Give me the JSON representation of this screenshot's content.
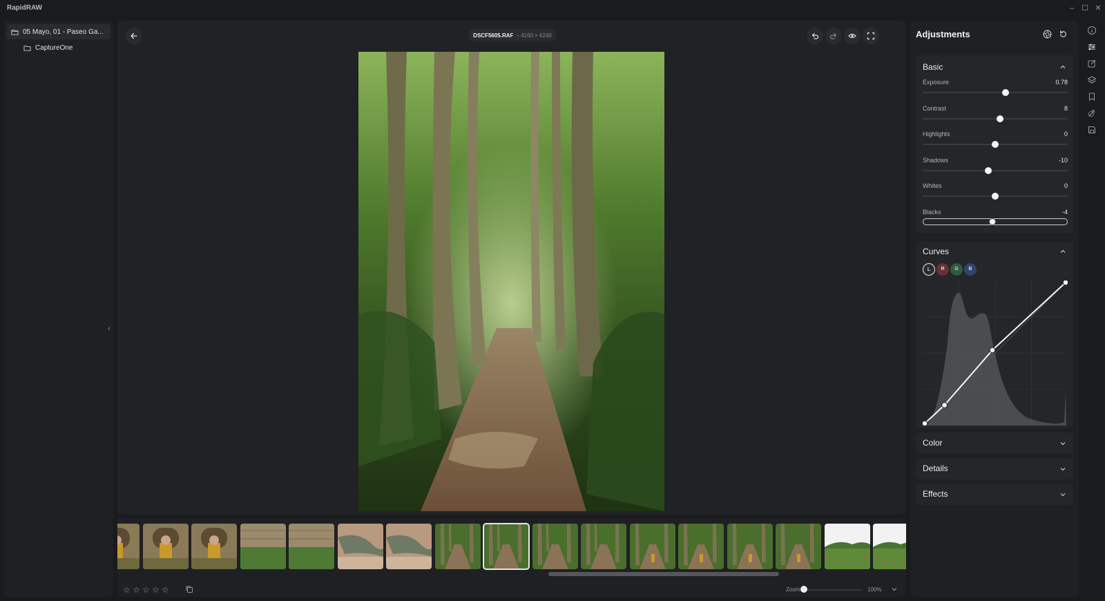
{
  "app": {
    "title": "RapidRAW"
  },
  "window": {
    "minimize": "–",
    "maximize": "☐",
    "close": "✕"
  },
  "sidebar": {
    "folders": [
      {
        "label": "05 Mayo, 01 - Paseo Ga...",
        "active": true
      },
      {
        "label": "CaptureOne",
        "active": false
      }
    ],
    "collapse_glyph": "‹"
  },
  "viewer": {
    "file_name": "DSCF5605.RAF",
    "file_dims": "– 4160 × 6240"
  },
  "filmstrip": {
    "thumbnails": [
      {
        "kind": "portrait-person",
        "selected": false
      },
      {
        "kind": "portrait-person",
        "selected": false
      },
      {
        "kind": "portrait-person",
        "selected": false
      },
      {
        "kind": "stone-wall",
        "selected": false
      },
      {
        "kind": "stone-wall",
        "selected": false
      },
      {
        "kind": "sculpture",
        "selected": false
      },
      {
        "kind": "sculpture",
        "selected": false
      },
      {
        "kind": "forest-path",
        "selected": false
      },
      {
        "kind": "forest-path",
        "selected": true
      },
      {
        "kind": "forest-path",
        "selected": false
      },
      {
        "kind": "forest-path",
        "selected": false
      },
      {
        "kind": "forest-person",
        "selected": false
      },
      {
        "kind": "forest-person",
        "selected": false
      },
      {
        "kind": "forest-person",
        "selected": false
      },
      {
        "kind": "forest-person",
        "selected": false
      },
      {
        "kind": "meadow",
        "selected": false
      },
      {
        "kind": "meadow",
        "selected": false
      }
    ],
    "rating": 0,
    "zoom_label": "Zoom",
    "zoom_value": "100%",
    "zoom_level": 0.0
  },
  "adjustments": {
    "title": "Adjustments",
    "basic": {
      "title": "Basic",
      "expanded": true,
      "sliders": [
        {
          "label": "Exposure",
          "value": "0.78",
          "position": 0.57
        },
        {
          "label": "Contrast",
          "value": "8",
          "position": 0.535
        },
        {
          "label": "Highlights",
          "value": "0",
          "position": 0.5
        },
        {
          "label": "Shadows",
          "value": "-10",
          "position": 0.45
        },
        {
          "label": "Whites",
          "value": "0",
          "position": 0.5
        },
        {
          "label": "Blacks",
          "value": "-4",
          "position": 0.48,
          "focused": true
        }
      ]
    },
    "curves": {
      "title": "Curves",
      "expanded": true,
      "channels": [
        {
          "label": "L",
          "color": "#2c2d30",
          "active": true
        },
        {
          "label": "R",
          "color": "#6b2f3a",
          "active": false
        },
        {
          "label": "G",
          "color": "#2f5a40",
          "active": false
        },
        {
          "label": "B",
          "color": "#2f4470",
          "active": false
        }
      ],
      "points": [
        [
          0,
          0
        ],
        [
          0.14,
          0.13
        ],
        [
          0.48,
          0.52
        ],
        [
          1,
          1
        ]
      ]
    },
    "collapsed_sections": [
      "Color",
      "Details",
      "Effects"
    ]
  },
  "colors": {
    "accent": "#f4f4f4",
    "panel": "#1f2023",
    "section": "#252629"
  }
}
